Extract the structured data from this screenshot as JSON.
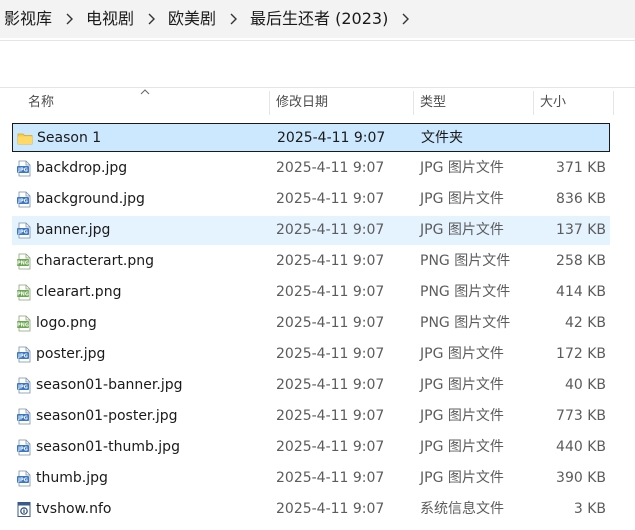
{
  "breadcrumb": {
    "items": [
      "影视库",
      "电视剧",
      "欧美剧",
      "最后生还者 (2023)"
    ]
  },
  "columns": {
    "name": "名称",
    "date": "修改日期",
    "type": "类型",
    "size": "大小"
  },
  "files": [
    {
      "name": "Season 1",
      "date": "2025-4-11 9:07",
      "type": "文件夹",
      "size": "",
      "icon": "folder-icon",
      "state": "selected"
    },
    {
      "name": "backdrop.jpg",
      "date": "2025-4-11 9:07",
      "type": "JPG 图片文件",
      "size": "371 KB",
      "icon": "jpg-file-icon",
      "state": ""
    },
    {
      "name": "background.jpg",
      "date": "2025-4-11 9:07",
      "type": "JPG 图片文件",
      "size": "836 KB",
      "icon": "jpg-file-icon",
      "state": ""
    },
    {
      "name": "banner.jpg",
      "date": "2025-4-11 9:07",
      "type": "JPG 图片文件",
      "size": "137 KB",
      "icon": "jpg-file-icon",
      "state": "hover"
    },
    {
      "name": "characterart.png",
      "date": "2025-4-11 9:07",
      "type": "PNG 图片文件",
      "size": "258 KB",
      "icon": "png-file-icon",
      "state": ""
    },
    {
      "name": "clearart.png",
      "date": "2025-4-11 9:07",
      "type": "PNG 图片文件",
      "size": "414 KB",
      "icon": "png-file-icon",
      "state": ""
    },
    {
      "name": "logo.png",
      "date": "2025-4-11 9:07",
      "type": "PNG 图片文件",
      "size": "42 KB",
      "icon": "png-file-icon",
      "state": ""
    },
    {
      "name": "poster.jpg",
      "date": "2025-4-11 9:07",
      "type": "JPG 图片文件",
      "size": "172 KB",
      "icon": "jpg-file-icon",
      "state": ""
    },
    {
      "name": "season01-banner.jpg",
      "date": "2025-4-11 9:07",
      "type": "JPG 图片文件",
      "size": "40 KB",
      "icon": "jpg-file-icon",
      "state": ""
    },
    {
      "name": "season01-poster.jpg",
      "date": "2025-4-11 9:07",
      "type": "JPG 图片文件",
      "size": "773 KB",
      "icon": "jpg-file-icon",
      "state": ""
    },
    {
      "name": "season01-thumb.jpg",
      "date": "2025-4-11 9:07",
      "type": "JPG 图片文件",
      "size": "440 KB",
      "icon": "jpg-file-icon",
      "state": ""
    },
    {
      "name": "thumb.jpg",
      "date": "2025-4-11 9:07",
      "type": "JPG 图片文件",
      "size": "390 KB",
      "icon": "jpg-file-icon",
      "state": ""
    },
    {
      "name": "tvshow.nfo",
      "date": "2025-4-11 9:07",
      "type": "系统信息文件",
      "size": "3 KB",
      "icon": "nfo-file-icon",
      "state": ""
    }
  ],
  "colors": {
    "selected_bg": "#cce8ff",
    "hover_bg": "#e5f3ff",
    "folder": "#f8cc48",
    "jpg_accent": "#3b78c4",
    "png_accent": "#6aa84f"
  }
}
